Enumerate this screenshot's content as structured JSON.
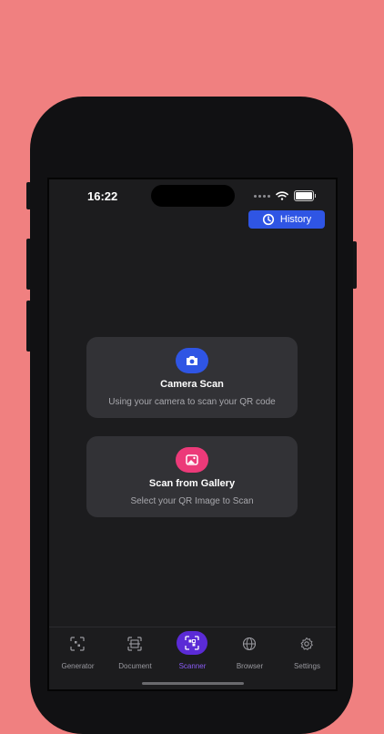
{
  "status": {
    "time": "16:22"
  },
  "header": {
    "history_label": "History"
  },
  "cards": [
    {
      "title": "Camera Scan",
      "subtitle": "Using your camera to scan your QR code",
      "icon": "camera-icon",
      "color": "#2f55e4"
    },
    {
      "title": "Scan from Gallery",
      "subtitle": "Select your QR Image to Scan",
      "icon": "gallery-icon",
      "color": "#ec3a79"
    }
  ],
  "tabs": [
    {
      "label": "Generator",
      "icon": "qr-generator-icon",
      "active": false
    },
    {
      "label": "Document",
      "icon": "document-scan-icon",
      "active": false
    },
    {
      "label": "Scanner",
      "icon": "qr-scanner-icon",
      "active": true
    },
    {
      "label": "Browser",
      "icon": "globe-icon",
      "active": false
    },
    {
      "label": "Settings",
      "icon": "gear-icon",
      "active": false
    }
  ],
  "colors": {
    "background": "#f08080",
    "accent": "#2f55e4",
    "active_tab": "#8a5cf6",
    "gallery": "#ec3a79"
  }
}
